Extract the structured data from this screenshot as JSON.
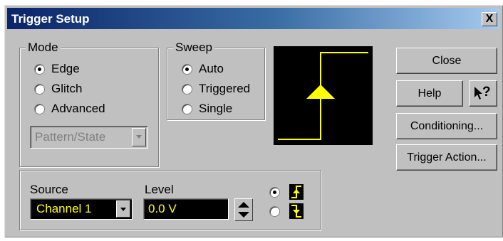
{
  "window": {
    "title": "Trigger Setup",
    "close_glyph": "X"
  },
  "mode": {
    "label": "Mode",
    "options": [
      {
        "label": "Edge",
        "selected": true
      },
      {
        "label": "Glitch",
        "selected": false
      },
      {
        "label": "Advanced",
        "selected": false
      }
    ],
    "pattern_dropdown": "Pattern/State"
  },
  "sweep": {
    "label": "Sweep",
    "options": [
      {
        "label": "Auto",
        "selected": true
      },
      {
        "label": "Triggered",
        "selected": false
      },
      {
        "label": "Single",
        "selected": false
      }
    ]
  },
  "buttons": {
    "close": "Close",
    "help": "Help",
    "help_icon": "?",
    "conditioning": "Conditioning...",
    "trigger_action": "Trigger Action..."
  },
  "source": {
    "label": "Source",
    "value": "Channel 1"
  },
  "level": {
    "label": "Level",
    "value": "0.0 V"
  },
  "slope": {
    "rising_selected": true
  },
  "colors": {
    "accent": "#ffff00",
    "display_bg": "#000000",
    "title_bar": "#0a246a"
  }
}
